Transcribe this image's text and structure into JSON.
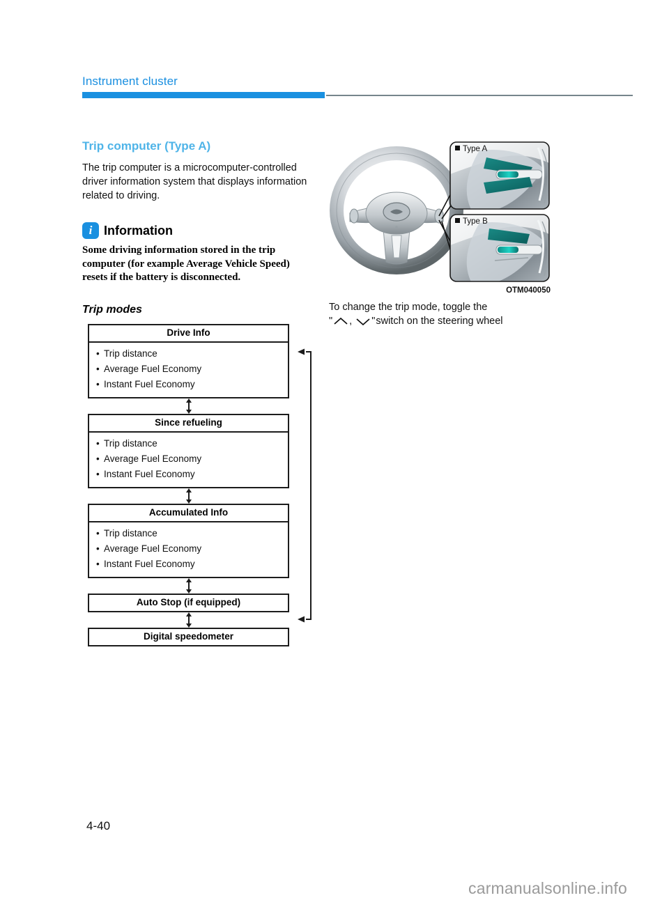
{
  "header": {
    "chapter_title": "Instrument cluster",
    "rule_color_blue": "#1a90e0",
    "rule_color_gray": "#76858c"
  },
  "left_column": {
    "section_heading": "Trip computer (Type A)",
    "intro_paragraph": "The trip computer is a microcomputer-controlled driver information system that displays information related to driving.",
    "information": {
      "icon_letter": "i",
      "title": "Information",
      "body": "Some driving information stored in the trip computer (for example Average Vehicle Speed) resets if the battery is disconnected."
    },
    "trip_modes_heading": "Trip modes"
  },
  "flow_chart": {
    "boxes": [
      {
        "title": "Drive Info",
        "items": [
          "Trip distance",
          "Average Fuel Economy",
          "Instant Fuel Economy"
        ]
      },
      {
        "title": "Since refueling",
        "items": [
          "Trip distance",
          "Average Fuel Economy",
          "Instant Fuel Economy"
        ]
      },
      {
        "title": "Accumulated Info",
        "items": [
          "Trip distance",
          "Average Fuel Economy",
          "Instant Fuel Economy"
        ]
      },
      {
        "title": "Auto Stop (if equipped)",
        "items": []
      },
      {
        "title": "Digital speedometer",
        "items": []
      }
    ]
  },
  "right_column": {
    "figure": {
      "label_type_a": "Type A",
      "label_type_b": "Type B",
      "figure_code": "OTM040050",
      "accent_color": "#16b5ab"
    },
    "caption_line_1": "To change the trip mode, toggle the",
    "caption_quote_open": "\"",
    "caption_comma": ",",
    "caption_quote_close": "\"",
    "caption_line_2_tail": " switch on the steering wheel"
  },
  "footer": {
    "page_number": "4-40",
    "watermark": "carmanualsonline.info"
  }
}
